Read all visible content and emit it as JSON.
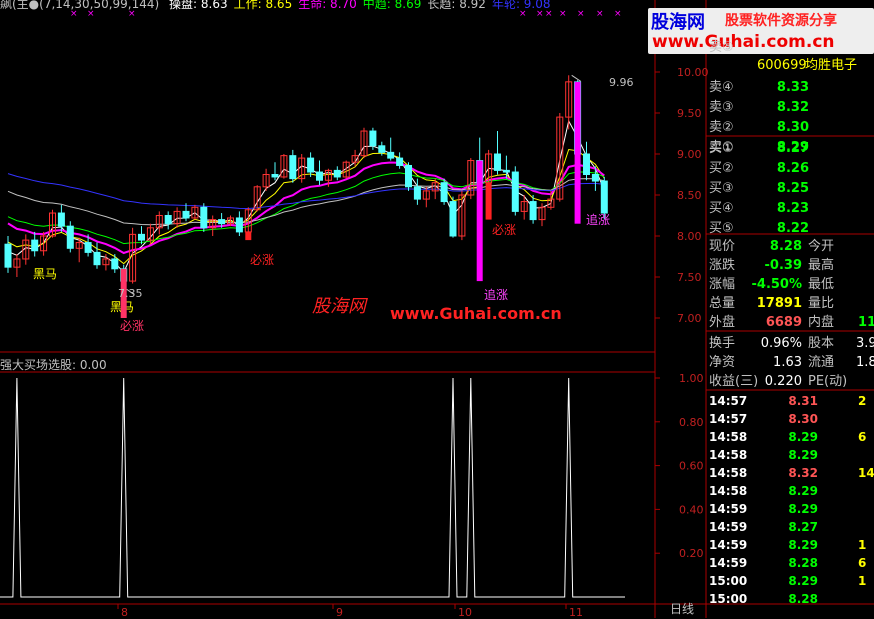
{
  "indicator_header": {
    "name": "飙(主●",
    "params": "(7,14,30,50,99,144)",
    "items": [
      {
        "label": "操盘: 8.63",
        "color": "#ffffff"
      },
      {
        "label": "工作: 8.65",
        "color": "#ffff00"
      },
      {
        "label": "生命: 8.70",
        "color": "#ff00ff"
      },
      {
        "label": "中趋: 8.69",
        "color": "#00ff00"
      },
      {
        "label": "长趋: 8.92",
        "color": "#c0c0c0"
      },
      {
        "label": "年轮: 9.08",
        "color": "#3333ff"
      }
    ]
  },
  "stock": {
    "code": "600699",
    "name": "均胜电子"
  },
  "watermark_top": {
    "logo": "股海网",
    "slogan": "股票软件资源分享",
    "url": "www.Guhai.com.cn"
  },
  "watermark_mid": {
    "logo": "股海网",
    "url": "www.Guhai.com.cn"
  },
  "quote": {
    "sell": [
      {
        "label": "卖⑤",
        "price": ""
      },
      {
        "label": "卖④",
        "price": "8.33"
      },
      {
        "label": "卖③",
        "price": "8.32"
      },
      {
        "label": "卖②",
        "price": "8.30"
      },
      {
        "label": "卖①",
        "price": "8.29"
      }
    ],
    "buy": [
      {
        "label": "买①",
        "price": "8.27"
      },
      {
        "label": "买②",
        "price": "8.26"
      },
      {
        "label": "买③",
        "price": "8.25"
      },
      {
        "label": "买④",
        "price": "8.23"
      },
      {
        "label": "买⑤",
        "price": "8.22"
      }
    ]
  },
  "stats": {
    "xianjia": {
      "label": "现价",
      "value": "8.28"
    },
    "jinkai": {
      "label": "今开"
    },
    "zhangdie": {
      "label": "涨跌",
      "value": "-0.39"
    },
    "zuigao": {
      "label": "最高"
    },
    "zhangfu": {
      "label": "涨幅",
      "value": "-4.50%"
    },
    "zuidi": {
      "label": "最低"
    },
    "zongliang": {
      "label": "总量",
      "value": "17891"
    },
    "liangbi": {
      "label": "量比"
    },
    "waipan": {
      "label": "外盘",
      "value": "6689"
    },
    "neipan": {
      "label": "内盘",
      "value": "11"
    },
    "huanshou": {
      "label": "换手",
      "value": "0.96%"
    },
    "guben": {
      "label": "股本",
      "value": "3.9"
    },
    "jingzi": {
      "label": "净资",
      "value": "1.63"
    },
    "liutong": {
      "label": "流通",
      "value": "1.8"
    },
    "shouyi": {
      "label": "收益(三)",
      "value": "0.220"
    },
    "pe": {
      "label": "PE(动)"
    }
  },
  "ticks": [
    {
      "time": "14:57",
      "price": "8.31",
      "vol": "2",
      "color": "#ff5555"
    },
    {
      "time": "14:57",
      "price": "8.30",
      "vol": "",
      "color": "#ff5555"
    },
    {
      "time": "14:58",
      "price": "8.29",
      "vol": "6",
      "color": "#00ff00"
    },
    {
      "time": "14:58",
      "price": "8.29",
      "vol": "",
      "color": "#00ff00"
    },
    {
      "time": "14:58",
      "price": "8.32",
      "vol": "14",
      "color": "#ff5555"
    },
    {
      "time": "14:58",
      "price": "8.29",
      "vol": "",
      "color": "#00ff00"
    },
    {
      "time": "14:59",
      "price": "8.29",
      "vol": "",
      "color": "#00ff00"
    },
    {
      "time": "14:59",
      "price": "8.27",
      "vol": "",
      "color": "#00ff00"
    },
    {
      "time": "14:59",
      "price": "8.29",
      "vol": "1",
      "color": "#00ff00"
    },
    {
      "time": "14:59",
      "price": "8.28",
      "vol": "6",
      "color": "#00ff00"
    },
    {
      "time": "15:00",
      "price": "8.29",
      "vol": "1",
      "color": "#00ff00"
    },
    {
      "time": "15:00",
      "price": "8.28",
      "vol": "",
      "color": "#00ff00"
    }
  ],
  "sub_panel": {
    "title": "强大买场选股: 0.00"
  },
  "period_label": "日线",
  "chart_data": [
    {
      "type": "candlestick",
      "y_axis_ticks": [
        "10.00",
        "9.50",
        "9.00",
        "8.50",
        "8.00",
        "7.50",
        "7.00"
      ],
      "x_axis_ticks": [
        "8",
        "9",
        "10",
        "11"
      ],
      "annotations": {
        "high": "9.96",
        "low": "7.35",
        "signals": [
          "黑马",
          "黑马",
          "必涨",
          "必涨",
          "追涨",
          "必涨",
          "追涨"
        ]
      },
      "ohlc": [
        [
          7.9,
          8.0,
          7.55,
          7.62
        ],
        [
          7.62,
          7.78,
          7.5,
          7.72
        ],
        [
          7.72,
          8.02,
          7.65,
          7.95
        ],
        [
          7.95,
          8.05,
          7.75,
          7.82
        ],
        [
          7.82,
          8.05,
          7.76,
          8.0
        ],
        [
          8.0,
          8.32,
          7.98,
          8.28
        ],
        [
          8.28,
          8.38,
          8.05,
          8.12
        ],
        [
          8.12,
          8.18,
          7.8,
          7.85
        ],
        [
          7.85,
          7.98,
          7.68,
          7.92
        ],
        [
          7.92,
          8.02,
          7.75,
          7.8
        ],
        [
          7.8,
          7.92,
          7.6,
          7.65
        ],
        [
          7.65,
          7.78,
          7.58,
          7.72
        ],
        [
          7.72,
          7.78,
          7.55,
          7.6
        ],
        [
          7.6,
          7.65,
          7.35,
          7.45
        ],
        [
          7.45,
          8.1,
          7.42,
          8.02
        ],
        [
          8.02,
          8.12,
          7.9,
          7.95
        ],
        [
          7.95,
          8.15,
          7.9,
          8.1
        ],
        [
          8.1,
          8.3,
          8.02,
          8.25
        ],
        [
          8.25,
          8.3,
          8.08,
          8.15
        ],
        [
          8.15,
          8.35,
          8.1,
          8.3
        ],
        [
          8.3,
          8.4,
          8.18,
          8.22
        ],
        [
          8.22,
          8.38,
          8.2,
          8.35
        ],
        [
          8.35,
          8.4,
          8.05,
          8.1
        ],
        [
          8.1,
          8.25,
          8.0,
          8.2
        ],
        [
          8.2,
          8.28,
          8.1,
          8.15
        ],
        [
          8.15,
          8.25,
          8.12,
          8.22
        ],
        [
          8.22,
          8.3,
          8.0,
          8.05
        ],
        [
          8.05,
          8.35,
          8.02,
          8.32
        ],
        [
          8.32,
          8.62,
          8.3,
          8.6
        ],
        [
          8.6,
          8.82,
          8.55,
          8.75
        ],
        [
          8.75,
          8.9,
          8.68,
          8.72
        ],
        [
          8.72,
          9.0,
          8.7,
          8.98
        ],
        [
          8.98,
          9.05,
          8.65,
          8.7
        ],
        [
          8.7,
          9.0,
          8.65,
          8.95
        ],
        [
          8.95,
          9.02,
          8.72,
          8.78
        ],
        [
          8.78,
          8.92,
          8.62,
          8.68
        ],
        [
          8.68,
          8.82,
          8.6,
          8.8
        ],
        [
          8.8,
          8.85,
          8.68,
          8.72
        ],
        [
          8.72,
          8.92,
          8.7,
          8.9
        ],
        [
          8.9,
          9.05,
          8.85,
          8.98
        ],
        [
          8.98,
          9.32,
          8.95,
          9.28
        ],
        [
          9.28,
          9.32,
          9.05,
          9.1
        ],
        [
          9.1,
          9.15,
          8.98,
          9.02
        ],
        [
          9.02,
          9.2,
          8.92,
          8.95
        ],
        [
          8.95,
          9.02,
          8.82,
          8.86
        ],
        [
          8.86,
          8.9,
          8.55,
          8.6
        ],
        [
          8.6,
          8.7,
          8.38,
          8.45
        ],
        [
          8.45,
          8.6,
          8.35,
          8.55
        ],
        [
          8.55,
          8.7,
          8.45,
          8.65
        ],
        [
          8.65,
          8.7,
          8.38,
          8.42
        ],
        [
          8.42,
          8.48,
          7.98,
          8.0
        ],
        [
          8.0,
          8.55,
          7.95,
          8.5
        ],
        [
          8.5,
          8.95,
          8.45,
          8.92
        ],
        [
          8.92,
          9.2,
          8.6,
          8.65
        ],
        [
          8.65,
          9.05,
          8.6,
          9.0
        ],
        [
          9.0,
          9.28,
          8.75,
          8.8
        ],
        [
          8.8,
          8.98,
          8.7,
          8.78
        ],
        [
          8.78,
          8.85,
          8.25,
          8.3
        ],
        [
          8.3,
          8.5,
          8.2,
          8.42
        ],
        [
          8.42,
          8.5,
          8.15,
          8.2
        ],
        [
          8.2,
          8.4,
          8.12,
          8.35
        ],
        [
          8.35,
          8.55,
          8.32,
          8.45
        ],
        [
          8.45,
          9.5,
          8.42,
          9.45
        ],
        [
          9.45,
          9.96,
          9.3,
          9.88
        ],
        [
          9.88,
          9.9,
          8.95,
          9.0
        ],
        [
          9.0,
          9.15,
          8.68,
          8.75
        ],
        [
          8.75,
          8.85,
          8.55,
          8.67
        ],
        [
          8.67,
          8.72,
          8.2,
          8.28
        ]
      ],
      "ma_series": [
        {
          "label": "操盘",
          "color": "#ffffff"
        },
        {
          "label": "工作",
          "color": "#ffff00"
        },
        {
          "label": "生命",
          "color": "#ff00ff"
        },
        {
          "label": "中趋",
          "color": "#00ff00"
        },
        {
          "label": "长趋",
          "color": "#c0c0c0"
        },
        {
          "label": "年轮",
          "color": "#3333ff"
        }
      ]
    },
    {
      "type": "line",
      "name": "强大买场选股",
      "y_axis_ticks": [
        "1.00",
        "0.80",
        "0.60",
        "0.40",
        "0.20"
      ],
      "signal_days": [
        1,
        13,
        50,
        52,
        63
      ]
    }
  ]
}
